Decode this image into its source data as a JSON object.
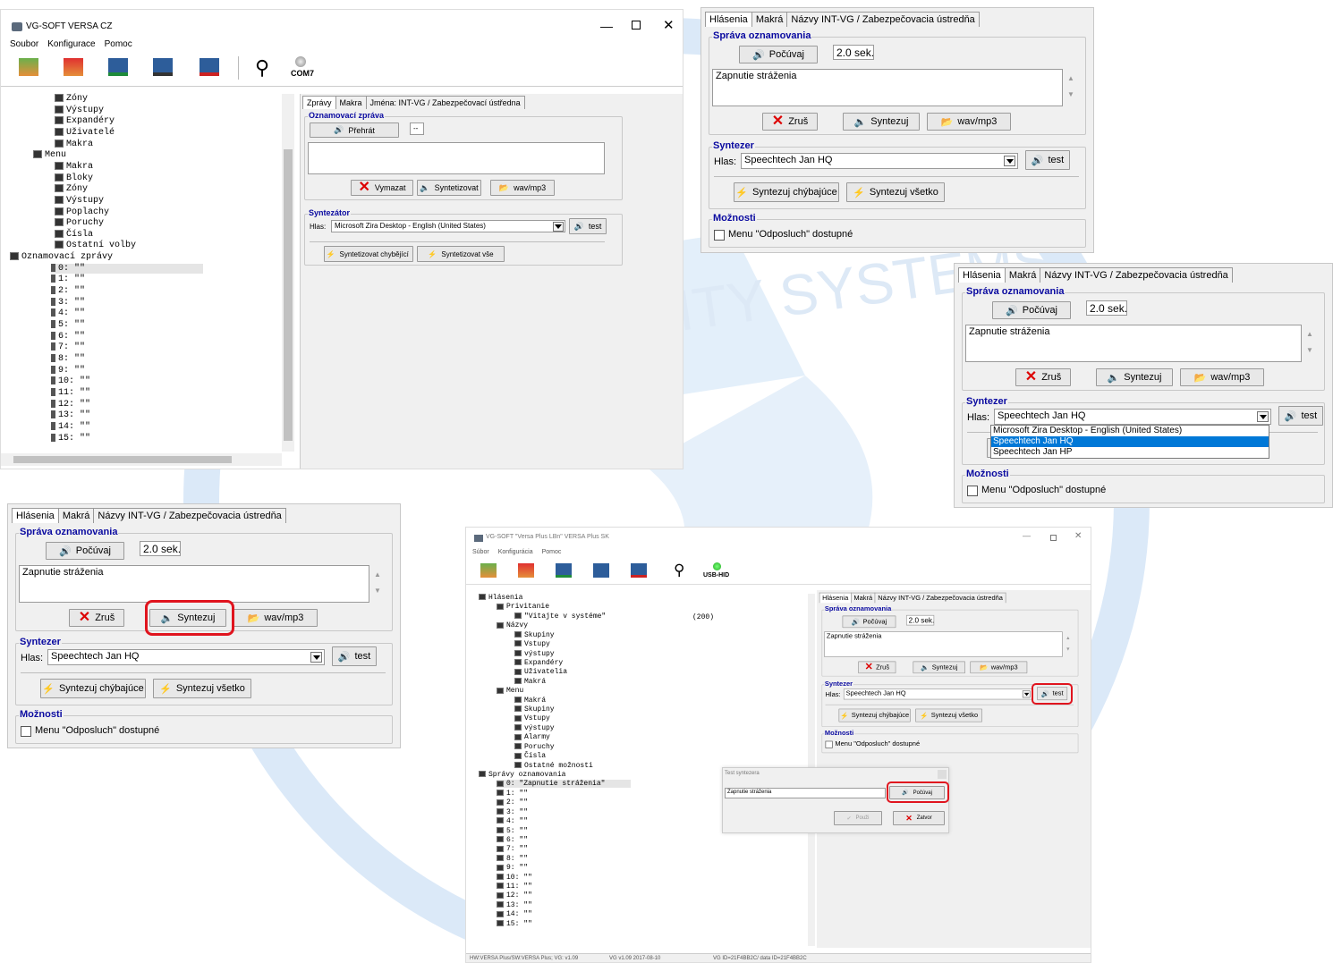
{
  "watermark_text": "ITY SYSTEMS",
  "win1": {
    "title": "VG-SOFT VERSA CZ",
    "menu": [
      "Soubor",
      "Konfigurace",
      "Pomoc"
    ],
    "port": "COM7",
    "tabs": [
      "Zprávy",
      "Makra",
      "Jména: INT-VG / Zabezpečovací ústředna"
    ],
    "group_msg": "Oznamovací zpráva",
    "play": "Přehrát",
    "time": "--",
    "btn_delete": "Vymazat",
    "btn_synth": "Syntetizovat",
    "btn_wav": "wav/mp3",
    "group_synth": "Syntezátor",
    "voice_label": "Hlas:",
    "voice": "Microsoft Zira Desktop - English (United States)",
    "test": "test",
    "btn_missing": "Syntetizovat chybějící",
    "btn_all": "Syntetizovat vše",
    "tree_top": [
      "Zóny",
      "Výstupy",
      "Expandéry",
      "Uživatelé",
      "Makra"
    ],
    "tree_menu_label": "Menu",
    "tree_menu": [
      "Makra",
      "Bloky",
      "Zóny",
      "Výstupy",
      "Poplachy",
      "Poruchy",
      "Čísla",
      "Ostatní volby"
    ],
    "tree_msgs_label": "Oznamovací zprávy",
    "tree_msgs": [
      "0: \"\"",
      "1: \"\"",
      "2: \"\"",
      "3: \"\"",
      "4: \"\"",
      "5: \"\"",
      "6: \"\"",
      "7: \"\"",
      "8: \"\"",
      "9: \"\"",
      "10: \"\"",
      "11: \"\"",
      "12: \"\"",
      "13: \"\"",
      "14: \"\"",
      "15: \"\""
    ]
  },
  "sk": {
    "tabs": [
      "Hlásenia",
      "Makrá",
      "Názvy INT-VG / Zabezpečovacia ústredňa"
    ],
    "group_msg": "Správa oznamovania",
    "play": "Počúvaj",
    "time": "2.0 sek.",
    "text": "Zapnutie stráženia",
    "btn_cancel": "Zruš",
    "btn_synth": "Syntezuj",
    "btn_wav": "wav/mp3",
    "group_synth": "Syntezer",
    "voice_label": "Hlas:",
    "voice": "Speechtech Jan HQ",
    "test": "test",
    "btn_missing": "Syntezuj chýbajúce",
    "btn_all": "Syntezuj všetko",
    "group_opt": "Možnosti",
    "opt": "Menu \"Odposluch\" dostupné",
    "voice_options": [
      "Microsoft Zira Desktop - English (United States)",
      "Speechtech Jan HQ",
      "Speechtech Jan HP"
    ]
  },
  "win2": {
    "title": "VG-SOFT \"Versa Plus LBn\" VERSA Plus SK",
    "menu": [
      "Súbor",
      "Konfigurácia",
      "Pomoc"
    ],
    "port": "USB-HID",
    "tree": [
      {
        "t": "Hlásenia",
        "lvl": 0
      },
      {
        "t": "Privitanie",
        "lvl": 1
      },
      {
        "t": "\"Vitajte v systéme\"",
        "lvl": 2
      },
      {
        "t": "Názvy",
        "lvl": 1
      },
      {
        "t": "Skupiny",
        "lvl": 2
      },
      {
        "t": "Vstupy",
        "lvl": 2
      },
      {
        "t": "výstupy",
        "lvl": 2
      },
      {
        "t": "Expandéry",
        "lvl": 2
      },
      {
        "t": "Uživatelia",
        "lvl": 2
      },
      {
        "t": "Makrá",
        "lvl": 2
      },
      {
        "t": "Menu",
        "lvl": 1
      },
      {
        "t": "Makrá",
        "lvl": 2
      },
      {
        "t": "Skupiny",
        "lvl": 2
      },
      {
        "t": "Vstupy",
        "lvl": 2
      },
      {
        "t": "výstupy",
        "lvl": 2
      },
      {
        "t": "Alarmy",
        "lvl": 2
      },
      {
        "t": "Poruchy",
        "lvl": 2
      },
      {
        "t": "Čísla",
        "lvl": 2
      },
      {
        "t": "Ostatné možnosti",
        "lvl": 2
      },
      {
        "t": "Správy oznamovania",
        "lvl": 0
      },
      {
        "t": "0: \"Zapnutie stráženia\"",
        "lvl": 1
      },
      {
        "t": "1: \"\"",
        "lvl": 1
      },
      {
        "t": "2: \"\"",
        "lvl": 1
      },
      {
        "t": "3: \"\"",
        "lvl": 1
      },
      {
        "t": "4: \"\"",
        "lvl": 1
      },
      {
        "t": "5: \"\"",
        "lvl": 1
      },
      {
        "t": "6: \"\"",
        "lvl": 1
      },
      {
        "t": "7: \"\"",
        "lvl": 1
      },
      {
        "t": "8: \"\"",
        "lvl": 1
      },
      {
        "t": "9: \"\"",
        "lvl": 1
      },
      {
        "t": "10: \"\"",
        "lvl": 1
      },
      {
        "t": "11: \"\"",
        "lvl": 1
      },
      {
        "t": "12: \"\"",
        "lvl": 1
      },
      {
        "t": "13: \"\"",
        "lvl": 1
      },
      {
        "t": "14: \"\"",
        "lvl": 1
      },
      {
        "t": "15: \"\"",
        "lvl": 1
      }
    ],
    "count": "(200)",
    "status": [
      "HW:VERSA Plus/SW:VERSA Plus; VG: v1.09",
      "VG v1.09 2017-08-10",
      "VG ID=21F4BB2C/ data ID=21F4BB2C"
    ],
    "dialog_title": "Test syntezera",
    "dialog_text": "Zapnutie stráženia",
    "dialog_play": "Počúvaj",
    "dialog_use": "Použi",
    "dialog_close": "Zatvor"
  }
}
